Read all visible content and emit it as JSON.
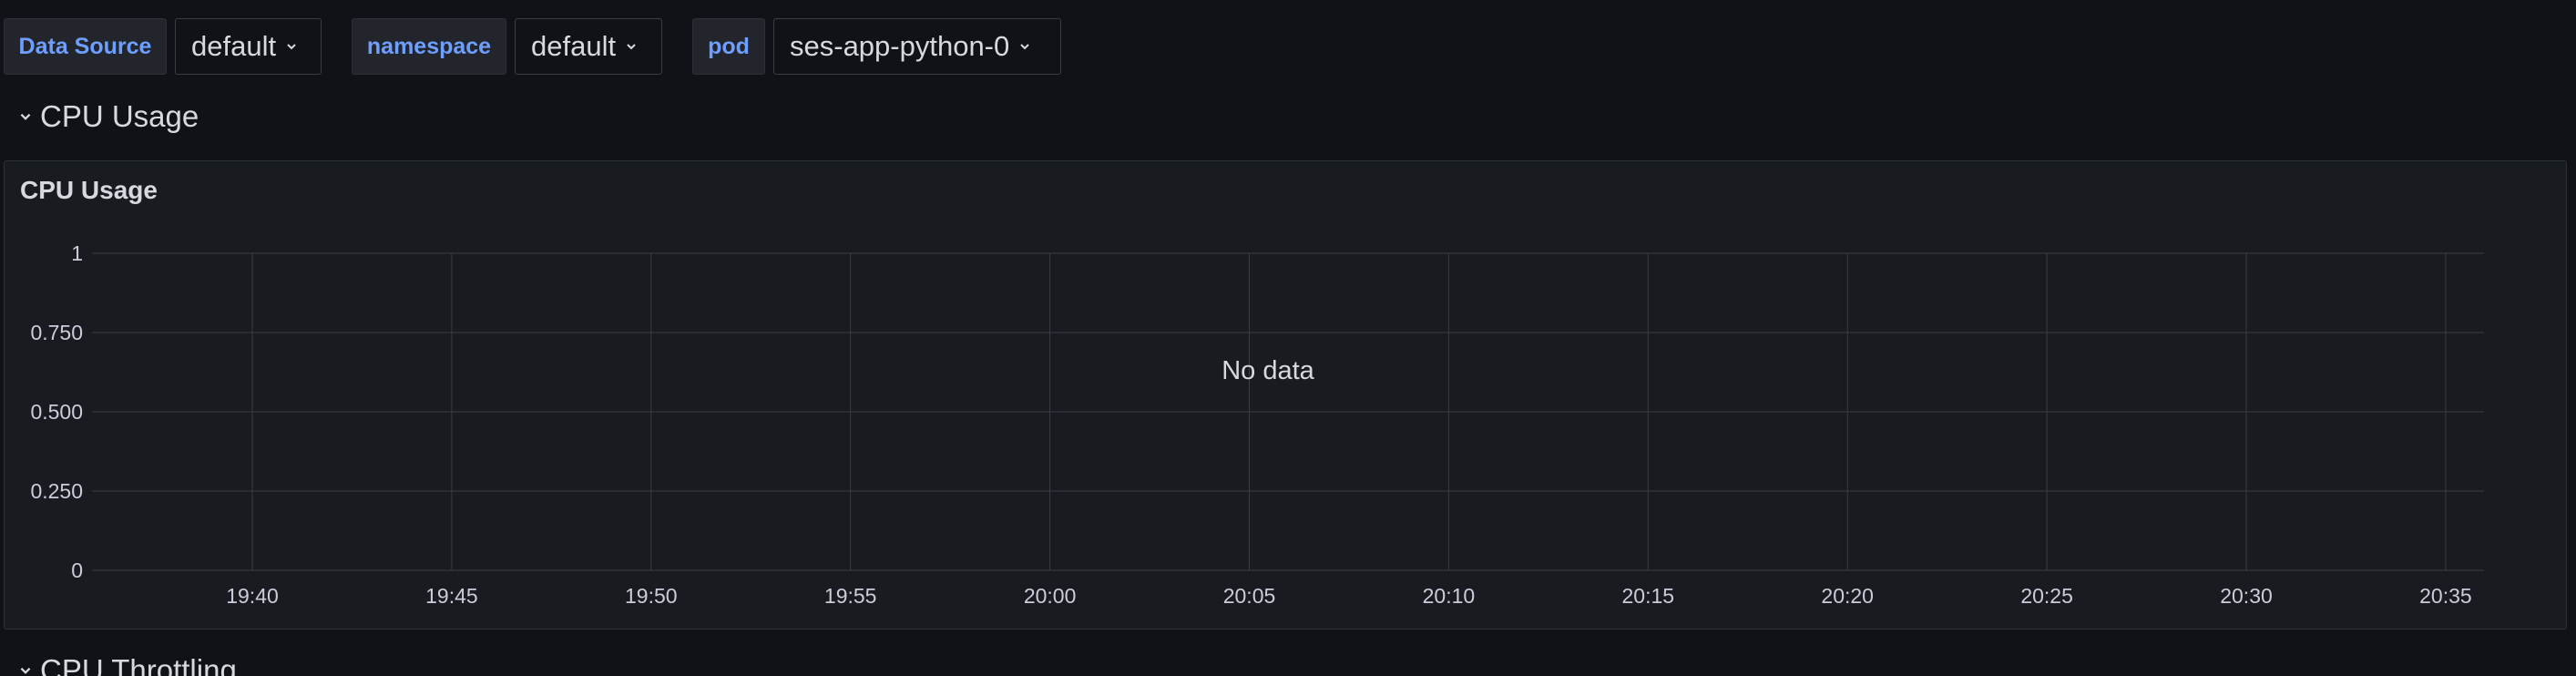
{
  "variables": [
    {
      "label": "Data Source",
      "value": "default"
    },
    {
      "label": "namespace",
      "value": "default"
    },
    {
      "label": "pod",
      "value": "ses-app-python-0"
    }
  ],
  "rows": [
    {
      "title": "CPU Usage"
    },
    {
      "title": "CPU Throttling"
    }
  ],
  "panel": {
    "title": "CPU Usage",
    "no_data_text": "No data"
  },
  "colors": {
    "background": "#111217",
    "panel": "#181b1f",
    "label_accent": "#6e9fff",
    "grid": "#3a3d45"
  },
  "chart_data": {
    "type": "line",
    "series": [],
    "x": [
      "19:40",
      "19:45",
      "19:50",
      "19:55",
      "20:00",
      "20:05",
      "20:10",
      "20:15",
      "20:20",
      "20:25",
      "20:30",
      "20:35"
    ],
    "y_ticks": [
      "0",
      "0.250",
      "0.500",
      "0.750",
      "1"
    ],
    "ylim": [
      0,
      1
    ],
    "grid": true,
    "title": "CPU Usage"
  }
}
